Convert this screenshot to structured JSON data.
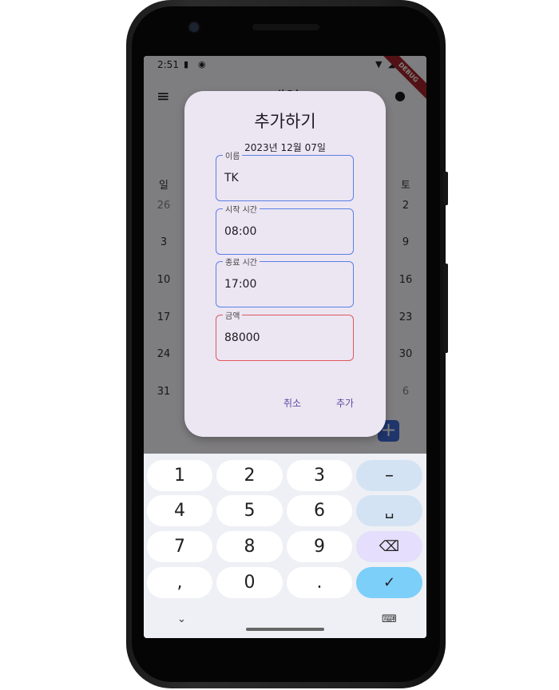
{
  "status": {
    "time": "2:51",
    "debug": "DEBUG"
  },
  "appbar": {
    "title": "매일",
    "menu_icon": "≡",
    "search_icon": "⌕",
    "account_icon": "●"
  },
  "calendar": {
    "weekday_left": "일",
    "weekday_right": "토",
    "left_col": [
      "26",
      "3",
      "10",
      "17",
      "24",
      "31"
    ],
    "right_col": [
      "2",
      "9",
      "16",
      "23",
      "30",
      "6"
    ]
  },
  "fab": {
    "label": "+"
  },
  "dialog": {
    "title": "추가하기",
    "date": "2023년 12월 07일",
    "fields": [
      {
        "label": "이름",
        "value": "TK"
      },
      {
        "label": "시작 시간",
        "value": "08:00"
      },
      {
        "label": "종료 시간",
        "value": "17:00"
      },
      {
        "label": "금액",
        "value": "88000"
      }
    ],
    "cancel": "취소",
    "add": "추가"
  },
  "keyboard": {
    "rows": [
      [
        "1",
        "2",
        "3",
        "–"
      ],
      [
        "4",
        "5",
        "6",
        "␣"
      ],
      [
        "7",
        "8",
        "9",
        "⌫"
      ],
      [
        ",",
        "0",
        ".",
        "✓"
      ]
    ],
    "hide_icon": "⌄",
    "switch_icon": "⌨"
  },
  "colors": {
    "field_border": "#5b7fe6",
    "error_border": "#e0575b",
    "dialog_bg": "#ece6f3",
    "accent": "#5a4ea3"
  }
}
